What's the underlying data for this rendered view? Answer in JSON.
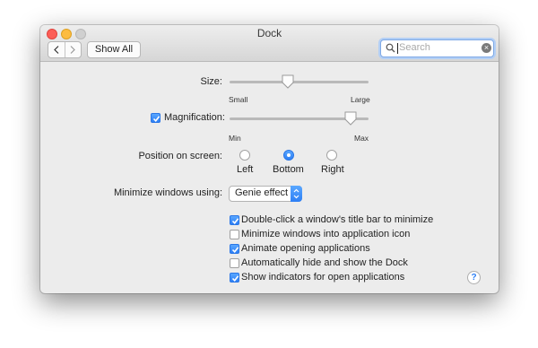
{
  "window": {
    "title": "Dock"
  },
  "toolbar": {
    "show_all_label": "Show All"
  },
  "search": {
    "placeholder": "Search"
  },
  "size": {
    "label": "Size:",
    "min_label": "Small",
    "max_label": "Large",
    "value": 0.42
  },
  "magnification": {
    "label": "Magnification:",
    "checked": true,
    "min_label": "Min",
    "max_label": "Max",
    "value": 0.87
  },
  "position": {
    "label": "Position on screen:",
    "options": [
      {
        "label": "Left",
        "selected": false
      },
      {
        "label": "Bottom",
        "selected": true
      },
      {
        "label": "Right",
        "selected": false
      }
    ]
  },
  "minimize": {
    "label": "Minimize windows using:",
    "selected": "Genie effect"
  },
  "checkboxes": [
    {
      "label": "Double-click a window's title bar to minimize",
      "checked": true
    },
    {
      "label": "Minimize windows into application icon",
      "checked": false
    },
    {
      "label": "Animate opening applications",
      "checked": true
    },
    {
      "label": "Automatically hide and show the Dock",
      "checked": false
    },
    {
      "label": "Show indicators for open applications",
      "checked": true
    }
  ],
  "help": {
    "label": "?"
  },
  "colors": {
    "accent": "#2d7ff5",
    "window_bg": "#ececec"
  }
}
